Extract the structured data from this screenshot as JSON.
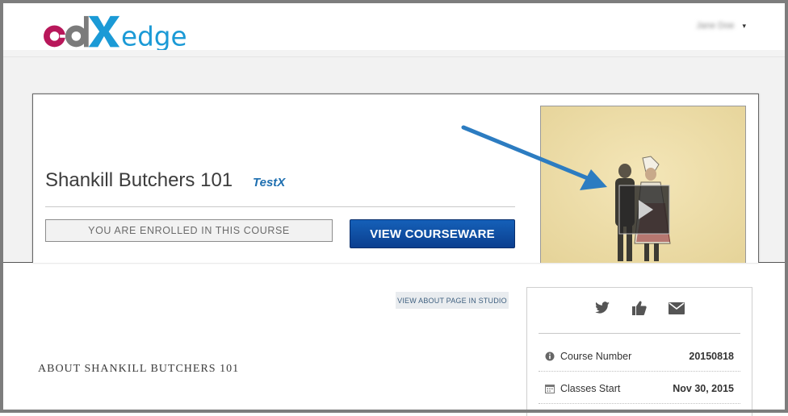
{
  "header": {
    "logo_text": "edX edge",
    "user_name": "Jane Doe",
    "user_caret": "▾"
  },
  "course": {
    "title": "Shankill Butchers 101",
    "org": "TestX",
    "enrolled_label": "YOU ARE ENROLLED IN THIS COURSE",
    "view_courseware_label": "VIEW COURSEWARE"
  },
  "main": {
    "studio_button_label": "VIEW ABOUT PAGE IN STUDIO",
    "about_heading": "ABOUT SHANKILL BUTCHERS 101"
  },
  "sidebar": {
    "share_icons": [
      "twitter-icon",
      "thumbs-up-icon",
      "email-icon"
    ],
    "details": [
      {
        "icon": "info-icon",
        "label": "Course Number",
        "value": "20150818"
      },
      {
        "icon": "calendar-icon",
        "label": "Classes Start",
        "value": "Nov 30, 2015"
      }
    ]
  },
  "colors": {
    "brand_magenta": "#b8175a",
    "brand_gray": "#7b7b7b",
    "brand_blue": "#1b9ad6",
    "button_blue": "#0b3f8f",
    "arrow_blue": "#2c7cc1",
    "org_blue": "#1e6fb0"
  }
}
